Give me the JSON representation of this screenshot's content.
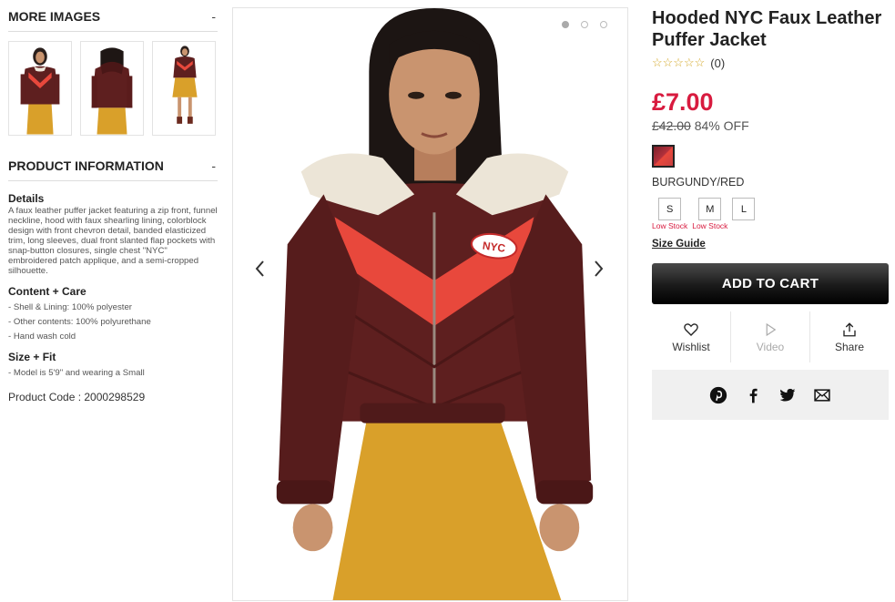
{
  "left": {
    "more_images_title": "MORE IMAGES",
    "more_images_toggle": "-",
    "product_info_title": "PRODUCT INFORMATION",
    "product_info_toggle": "-",
    "details_title": "Details",
    "details_text": "A faux leather puffer jacket featuring a zip front, funnel neckline, hood with faux shearling lining, colorblock design with front chevron detail, banded elasticized trim, long sleeves, dual front slanted flap pockets with snap-button closures, single chest \"NYC\" embroidered patch applique, and a semi-cropped silhouette.",
    "content_title": "Content + Care",
    "content_items": [
      "- Shell & Lining: 100% polyester",
      "- Other contents: 100% polyurethane",
      "- Hand wash cold"
    ],
    "fit_title": "Size + Fit",
    "fit_items": [
      "- Model is 5'9\" and wearing a Small"
    ],
    "product_code": "Product Code : 2000298529"
  },
  "gallery": {
    "patch_text": "NYC",
    "active_dot": 0,
    "dot_count": 3
  },
  "product": {
    "title": "Hooded NYC Faux Leather Puffer Jacket",
    "stars": "☆☆☆☆☆",
    "rating_count": "(0)",
    "price": "£7.00",
    "original_price": "£42.00",
    "discount": "84% OFF",
    "color_name": "BURGUNDY/RED",
    "sizes": [
      {
        "label": "S",
        "stock": "Low Stock"
      },
      {
        "label": "M",
        "stock": "Low Stock"
      },
      {
        "label": "L",
        "stock": ""
      }
    ],
    "size_guide": "Size Guide",
    "add_to_cart": "ADD TO CART",
    "actions": {
      "wishlist": "Wishlist",
      "video": "Video",
      "share": "Share"
    }
  },
  "colors": {
    "price_red": "#d81b3f",
    "jacket_burgundy": "#5e1f1f",
    "jacket_red": "#e8483c",
    "skirt_mustard": "#d9a02a"
  }
}
